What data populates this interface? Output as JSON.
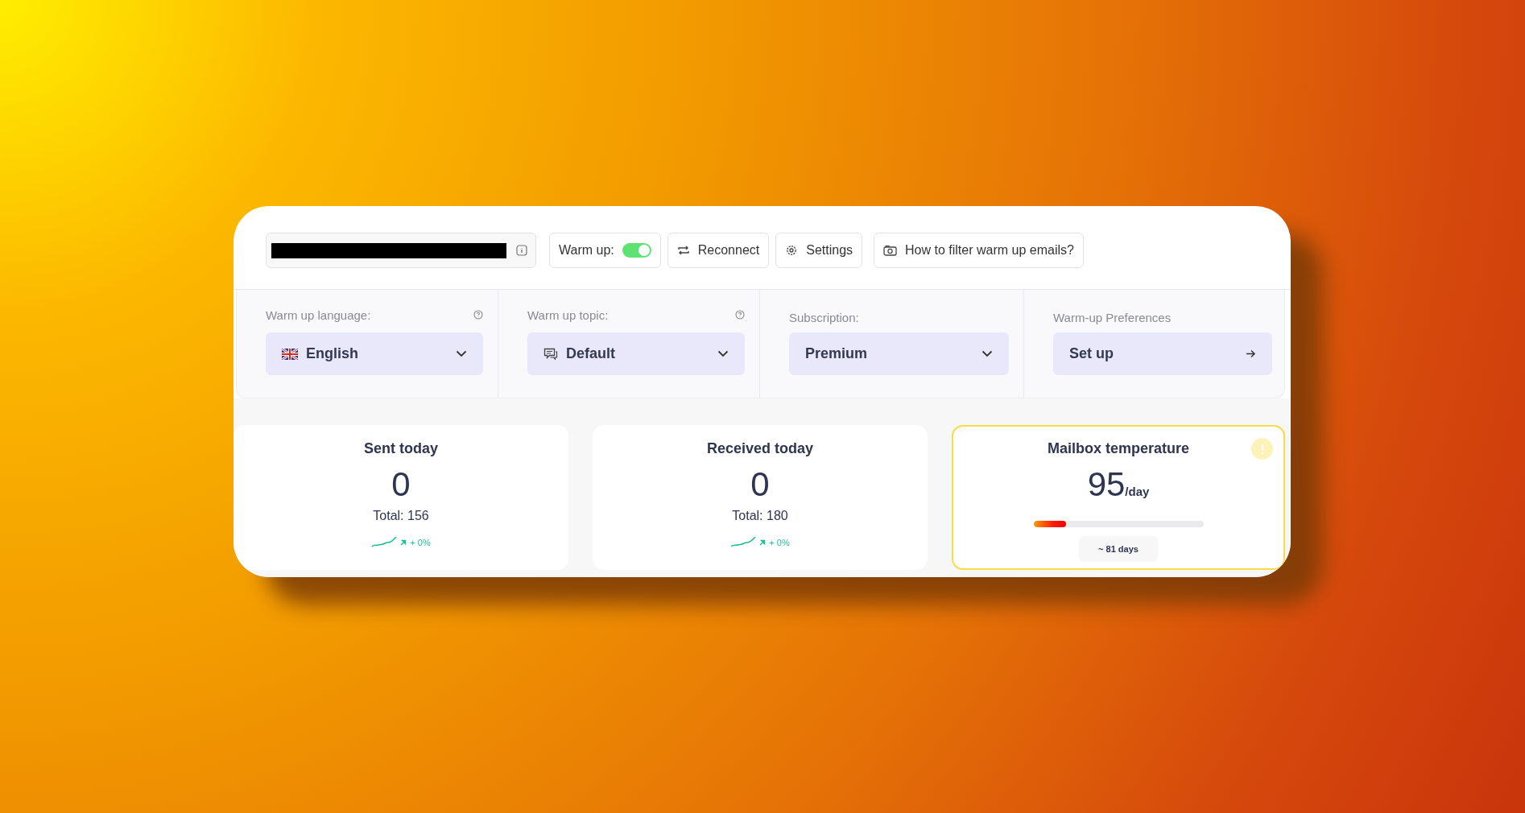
{
  "toolbar": {
    "account_field": {
      "redacted": true
    },
    "warm_up": {
      "label": "Warm up:",
      "on": true
    },
    "buttons": [
      {
        "kind": "reconnect",
        "label": "Reconnect"
      },
      {
        "kind": "settings",
        "label": "Settings"
      },
      {
        "kind": "video",
        "label": "How to filter warm up emails?"
      }
    ]
  },
  "settings": [
    {
      "kind": "language",
      "label": "Warm up language:",
      "help": true,
      "value": "English"
    },
    {
      "kind": "topic",
      "label": "Warm up topic:",
      "help": true,
      "value": "Default"
    },
    {
      "kind": "dropdown",
      "label": "Subscription:",
      "help": false,
      "value": "Premium"
    },
    {
      "kind": "link",
      "label": "Warm-up Preferences",
      "help": false,
      "value": "Set up"
    }
  ],
  "stats": [
    {
      "kind": "count",
      "title": "Sent today",
      "value": "0",
      "total": "Total: 156",
      "trend": "+ 0%"
    },
    {
      "kind": "count",
      "title": "Received today",
      "value": "0",
      "total": "Total: 180",
      "trend": "+ 0%"
    },
    {
      "kind": "temperature",
      "title": "Mailbox temperature",
      "value": "95",
      "unit": "/day",
      "level": 0.19,
      "note": "~ 81 days",
      "warning": true
    }
  ]
}
